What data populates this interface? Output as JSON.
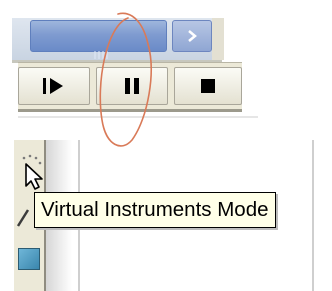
{
  "tooltip": {
    "text": "Virtual Instruments Mode"
  },
  "toolbar": {
    "buttons": [
      {
        "icon": "play-step-icon"
      },
      {
        "icon": "pause-icon"
      },
      {
        "icon": "stop-icon"
      }
    ]
  },
  "palette": {
    "tools": [
      {
        "icon": "arrow-cursor-icon"
      },
      {
        "icon": "color-swatch-icon"
      }
    ]
  },
  "colors": {
    "scrollbar_thumb": "#7f9bd0",
    "toolbar_face": "#ece9d8",
    "tooltip_bg": "#ffffe8",
    "annotation_stroke": "#d97a58",
    "swatch": "#3a86ad"
  }
}
